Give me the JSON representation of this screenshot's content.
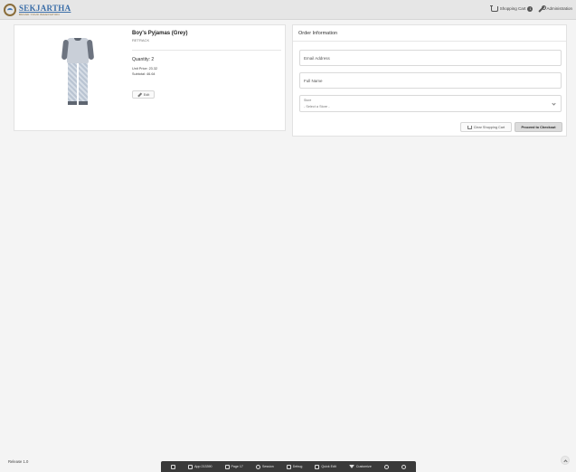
{
  "header": {
    "logo_name": "SEKJARTHA",
    "logo_tagline": "BRAND YOUR IMAGINATION",
    "cart_label": "Shopping Cart",
    "cart_count": "1",
    "admin_label": "Administration"
  },
  "product": {
    "title": "Boy's Pyjamas (Grey)",
    "sku": "RETRACK",
    "quantity": "Quantity: 2",
    "unit_price": "Unit Price: 23.32",
    "subtotal": "Subtotal: 46.64",
    "edit_label": "Edit"
  },
  "order": {
    "title": "Order Information",
    "email_placeholder": "Email Address",
    "name_placeholder": "Full Name",
    "store_label": "Store",
    "store_value": "- Select a Store -",
    "clear_label": "Clear Shopping Cart",
    "checkout_label": "Proceed to Checkout"
  },
  "footer": {
    "release": "Release 1.0"
  },
  "devbar": {
    "items": [
      {
        "label": ""
      },
      {
        "label": "App 213390"
      },
      {
        "label": "Page 17"
      },
      {
        "label": "Session"
      },
      {
        "label": "Debug"
      },
      {
        "label": "Quick Edit"
      },
      {
        "label": "Customize"
      },
      {
        "label": ""
      },
      {
        "label": ""
      }
    ]
  }
}
